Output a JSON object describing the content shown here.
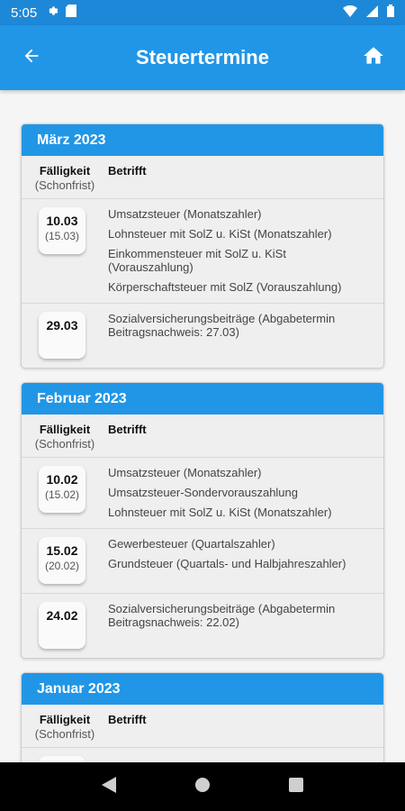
{
  "status": {
    "time": "5:05"
  },
  "appbar": {
    "title": "Steuertermine"
  },
  "columns": {
    "due": "Fälligkeit",
    "grace": "(Schonfrist)",
    "subject": "Betrifft"
  },
  "months": [
    {
      "title": "März 2023",
      "rows": [
        {
          "date": "10.03",
          "grace": "(15.03)",
          "items": [
            "Umsatzsteuer (Monatszahler)",
            "Lohnsteuer mit SolZ u. KiSt (Monatszahler)",
            "Einkommensteuer mit SolZ u. KiSt (Vorauszahlung)",
            "Körperschaftsteuer mit SolZ (Vorauszahlung)"
          ]
        },
        {
          "date": "29.03",
          "grace": "",
          "items": [
            "Sozialversicherungsbeiträge (Abgabetermin Beitragsnachweis: 27.03)"
          ]
        }
      ]
    },
    {
      "title": "Februar 2023",
      "rows": [
        {
          "date": "10.02",
          "grace": "(15.02)",
          "items": [
            "Umsatzsteuer (Monatszahler)",
            "Umsatzsteuer-Sondervorauszahlung",
            "Lohnsteuer mit SolZ u. KiSt (Monatszahler)"
          ]
        },
        {
          "date": "15.02",
          "grace": "(20.02)",
          "items": [
            "Gewerbesteuer (Quartalszahler)",
            "Grundsteuer (Quartals- und Halbjahreszahler)"
          ]
        },
        {
          "date": "24.02",
          "grace": "",
          "items": [
            "Sozialversicherungsbeiträge (Abgabetermin Beitragsnachweis: 22.02)"
          ]
        }
      ]
    },
    {
      "title": "Januar 2023",
      "rows": [
        {
          "date": "",
          "grace": "",
          "items": []
        }
      ]
    }
  ]
}
